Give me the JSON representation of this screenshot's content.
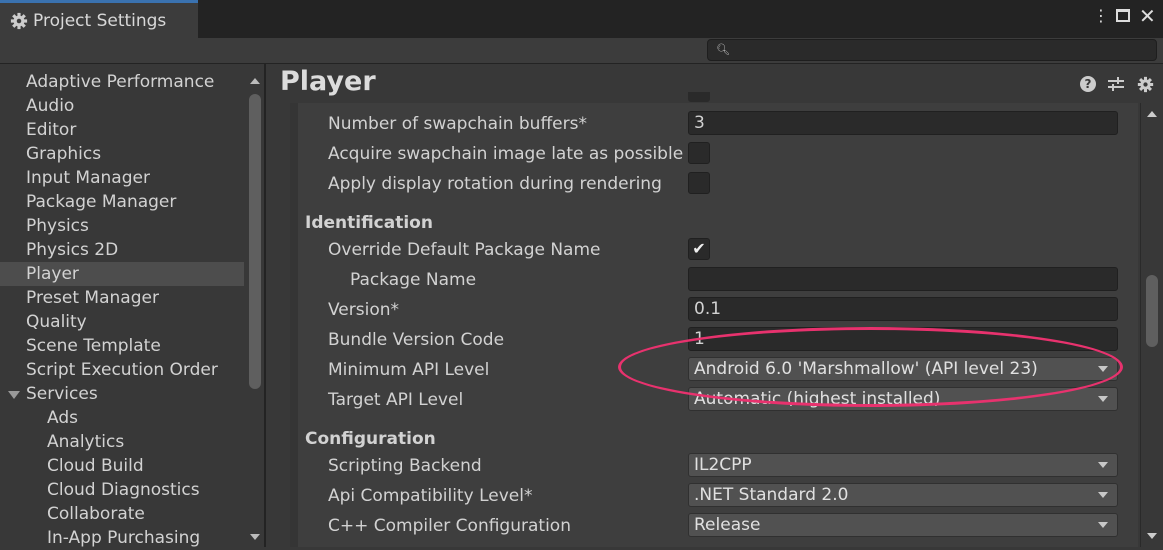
{
  "window": {
    "title": "Project Settings",
    "menu_icon": "kebab-icon",
    "maximize_icon": "maximize-icon",
    "close_icon": "close-icon"
  },
  "search": {
    "placeholder": "",
    "icon": "search-icon"
  },
  "sidebar": {
    "items": [
      {
        "label": "Adaptive Performance"
      },
      {
        "label": "Audio"
      },
      {
        "label": "Editor"
      },
      {
        "label": "Graphics"
      },
      {
        "label": "Input Manager"
      },
      {
        "label": "Package Manager"
      },
      {
        "label": "Physics"
      },
      {
        "label": "Physics 2D"
      },
      {
        "label": "Player",
        "selected": true
      },
      {
        "label": "Preset Manager"
      },
      {
        "label": "Quality"
      },
      {
        "label": "Scene Template"
      },
      {
        "label": "Script Execution Order"
      },
      {
        "label": "Services",
        "expanded": true
      },
      {
        "label": "Ads",
        "sub": true
      },
      {
        "label": "Analytics",
        "sub": true
      },
      {
        "label": "Cloud Build",
        "sub": true
      },
      {
        "label": "Cloud Diagnostics",
        "sub": true
      },
      {
        "label": "Collaborate",
        "sub": true
      },
      {
        "label": "In-App Purchasing",
        "sub": true
      }
    ]
  },
  "panel": {
    "title": "Player",
    "icons": [
      "help-icon",
      "presets-icon",
      "settings-icon"
    ]
  },
  "rows": {
    "swapchain": {
      "label": "Number of swapchain buffers*",
      "value": "3"
    },
    "acquire": {
      "label": "Acquire swapchain image late as possible",
      "checked": false
    },
    "rotation": {
      "label": "Apply display rotation during rendering",
      "checked": false
    },
    "identification": "Identification",
    "override": {
      "label": "Override Default Package Name",
      "checked": true
    },
    "package": {
      "label": "Package Name",
      "value": ""
    },
    "version": {
      "label": "Version*",
      "value": "0.1"
    },
    "bundle": {
      "label": "Bundle Version Code",
      "value": "1"
    },
    "minapi": {
      "label": "Minimum API Level",
      "value": "Android 6.0 'Marshmallow' (API level 23)"
    },
    "targetapi": {
      "label": "Target API Level",
      "value": "Automatic (highest installed)"
    },
    "configuration": "Configuration",
    "backend": {
      "label": "Scripting Backend",
      "value": "IL2CPP"
    },
    "apicompat": {
      "label": "Api Compatibility Level*",
      "value": ".NET Standard 2.0"
    },
    "cpp": {
      "label": "C++ Compiler Configuration",
      "value": "Release"
    }
  },
  "colors": {
    "highlight": "#e8326e",
    "tab_accent": "#3a72b0"
  }
}
